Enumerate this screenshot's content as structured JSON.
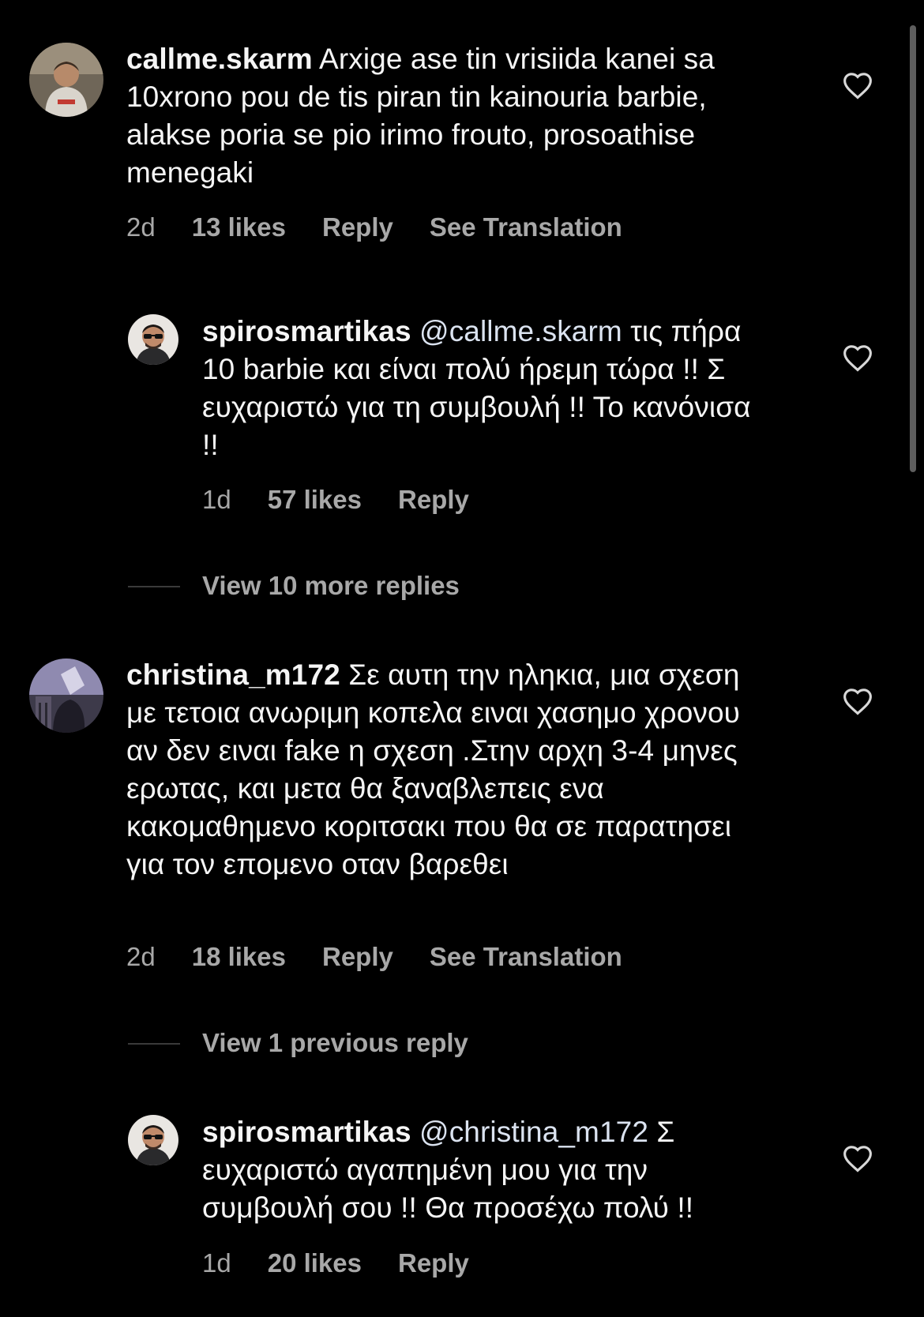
{
  "comments": [
    {
      "username": "callme.skarm",
      "text": "Arxige ase tin vrisiida kanei sa 10xrono pou de tis piran tin kainouria barbie, alakse poria se pio irimo frouto, prosoathise menegaki",
      "time": "2d",
      "likes": "13 likes",
      "reply_label": "Reply",
      "translate_label": "See Translation",
      "replies": [
        {
          "username": "spirosmartikas",
          "mention": "@callme.skarm",
          "text": "τις πήρα 10 barbie και είναι πολύ ήρεμη τώρα !! Σ ευχαριστώ για τη συμβουλή !! Το κανόνισα !!",
          "time": "1d",
          "likes": "57 likes",
          "reply_label": "Reply"
        }
      ],
      "view_replies_label": "View 10 more replies"
    },
    {
      "username": "christina_m172",
      "text": "Σε αυτη την ηληκια, μια σχεση με τετοια  ανωριμη κοπελα ειναι χασημο χρονου αν δεν ειναι fake η σχεση .Στην αρχη 3-4 μηνες ερωτας, και μετα θα ξαναβλεπεις ενα κακομαθημενο κοριτσακι που θα σε παρατησει για τον επομενο οταν βαρεθει",
      "time": "2d",
      "likes": "18 likes",
      "reply_label": "Reply",
      "translate_label": "See Translation",
      "view_replies_label": "View 1 previous reply",
      "replies": [
        {
          "username": "spirosmartikas",
          "mention": "@christina_m172",
          "text": "Σ ευχαριστώ αγαπημένη μου για την συμβουλή σου !! Θα προσέχω πολύ !!",
          "time": "1d",
          "likes": "20 likes",
          "reply_label": "Reply"
        }
      ]
    }
  ],
  "colors": {
    "background": "#000000",
    "primary_text": "#f5f5f5",
    "secondary_text": "#a8a8a8",
    "scrollbar": "#5e5e5e"
  },
  "icons": {
    "like": "heart-outline-icon"
  }
}
